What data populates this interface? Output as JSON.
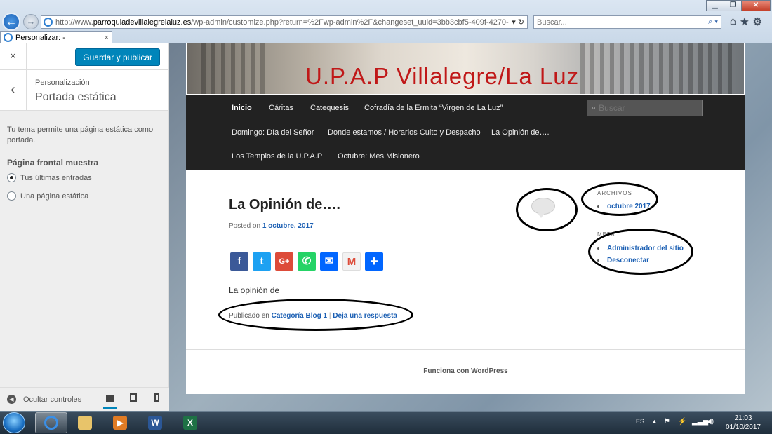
{
  "browser": {
    "url_plain_prefix": "http://www.",
    "url_domain": "parroquiadevillalegrelaluz.es",
    "url_path": "/wp-admin/customize.php?return=%2Fwp-admin%2F&changeset_uuid=3bb3cbf5-409f-4270-9b71-d477d6c6a",
    "search_placeholder": "Buscar...",
    "tab_title": "Personalizar: -",
    "tab_close": "×"
  },
  "customizer": {
    "close_label": "×",
    "publish_label": "Guardar y publicar",
    "back_label": "‹",
    "breadcrumb": "Personalización",
    "section_title": "Portada estática",
    "description": "Tu tema permite una página estática como portada.",
    "front_page_label": "Página frontal muestra",
    "options": [
      {
        "label": "Tus últimas entradas",
        "checked": true
      },
      {
        "label": "Una página estática",
        "checked": false
      }
    ],
    "hide_controls_label": "Ocultar controles"
  },
  "site": {
    "title": "U.P.A.P    Villalegre/La Luz",
    "nav": {
      "items": [
        "Inicio",
        "Cáritas",
        "Catequesis",
        "Cofradía de la Ermita “Virgen de La Luz”",
        "Domingo: Día del Señor",
        "Donde estamos / Horarios Culto y Despacho",
        "La Opinión de….",
        "Los Templos de la U.P.A.P",
        "Octubre: Mes Misionero"
      ],
      "search_placeholder": "Buscar"
    },
    "post": {
      "title": "La Opinión de….",
      "posted_on_label": "Posted on",
      "date": "1 octubre, 2017",
      "content": "La opinión de",
      "published_in_label": "Publicado en",
      "category": "Categoría Blog 1",
      "separator": "|",
      "reply_link": "Deja una respuesta"
    },
    "sidebar": {
      "archives_title": "ARCHIVOS",
      "archives": [
        "octubre 2017"
      ],
      "meta_title": "META",
      "meta_links": [
        "Administrador del sitio",
        "Desconectar"
      ]
    },
    "footer": "Funciona con WordPress"
  },
  "taskbar": {
    "language": "ES",
    "time": "21:03",
    "date": "01/10/2017",
    "word_glyph": "W",
    "excel_glyph": "X"
  },
  "colors": {
    "wp_blue": "#0085ba",
    "link_blue": "#1b5fb3",
    "nav_bg": "#222222",
    "title_red": "#c01818",
    "facebook": "#3b5998",
    "twitter": "#1da1f2",
    "google_plus": "#dd4b39",
    "whatsapp": "#25d366",
    "email": "#0166ff",
    "gmail": "#dd4b39",
    "share": "#0166ff"
  }
}
